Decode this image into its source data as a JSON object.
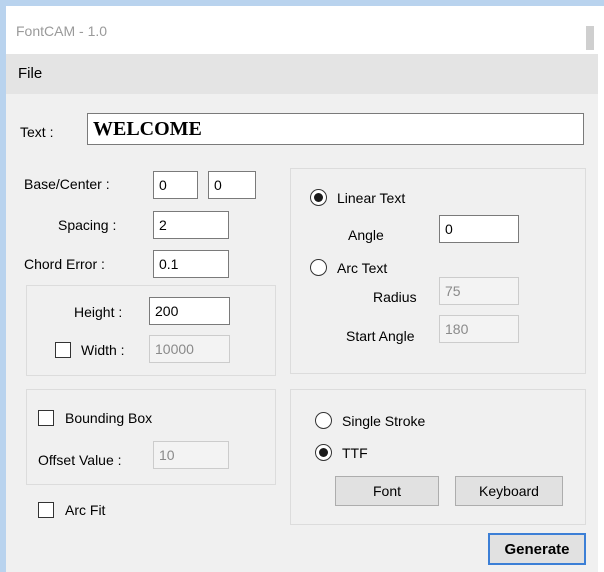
{
  "window": {
    "title": "FontCAM - 1.0"
  },
  "menu": {
    "file": "File"
  },
  "text_field": {
    "label": "Text :",
    "value": "WELCOME"
  },
  "base_center": {
    "label": "Base/Center :",
    "x": "0",
    "y": "0"
  },
  "spacing": {
    "label": "Spacing :",
    "value": "2"
  },
  "chord_error": {
    "label": "Chord Error :",
    "value": "0.1"
  },
  "height": {
    "label": "Height :",
    "value": "200"
  },
  "width": {
    "label": "Width :",
    "value": "10000",
    "checked": false
  },
  "linear_text": {
    "label": "Linear Text",
    "selected": true,
    "angle_label": "Angle",
    "angle_value": "0"
  },
  "arc_text": {
    "label": "Arc Text",
    "selected": false,
    "radius_label": "Radius",
    "radius_value": "75",
    "start_angle_label": "Start Angle",
    "start_angle_value": "180"
  },
  "bounding_box": {
    "label": "Bounding Box",
    "checked": false,
    "offset_label": "Offset Value :",
    "offset_value": "10"
  },
  "arc_fit": {
    "label": "Arc Fit",
    "checked": false
  },
  "stroke_type": {
    "single_stroke_label": "Single Stroke",
    "single_stroke_selected": false,
    "ttf_label": "TTF",
    "ttf_selected": true
  },
  "buttons": {
    "font": "Font",
    "keyboard": "Keyboard",
    "generate": "Generate"
  },
  "colors": {
    "frame": "#b9d3ee",
    "window_bg": "#f0f0f0",
    "menubar": "#e4e4e4",
    "accent": "#3c7fd6"
  }
}
